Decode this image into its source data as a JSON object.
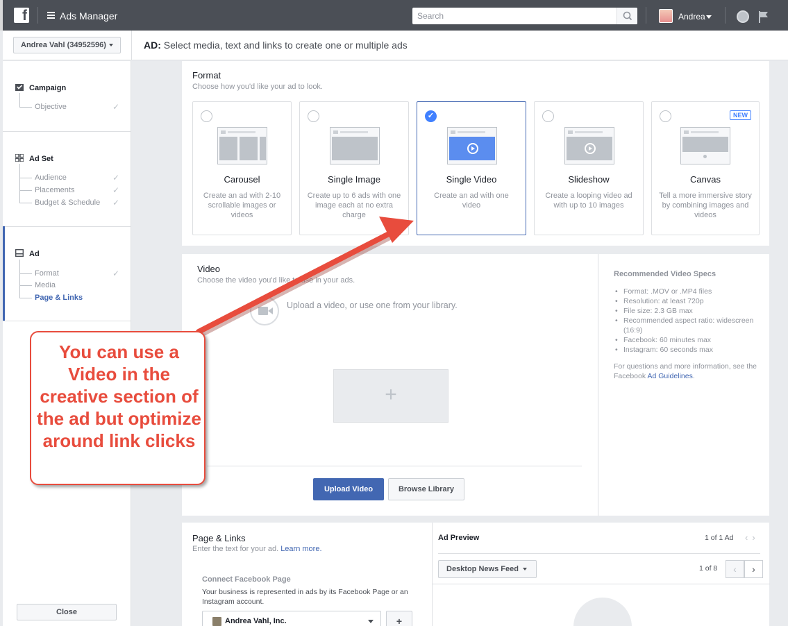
{
  "topbar": {
    "logo": "f",
    "app_title": "Ads Manager",
    "search_placeholder": "Search",
    "user_name": "Andrea"
  },
  "subheader": {
    "account": "Andrea Vahl (34952596)",
    "heading_prefix": "AD:",
    "heading_text": "Select media, text and links to create one or multiple ads"
  },
  "sidebar": {
    "campaign": {
      "title": "Campaign",
      "items": [
        {
          "label": "Objective",
          "done": true
        }
      ]
    },
    "adset": {
      "title": "Ad Set",
      "items": [
        {
          "label": "Audience",
          "done": true
        },
        {
          "label": "Placements",
          "done": true
        },
        {
          "label": "Budget & Schedule",
          "done": true
        }
      ]
    },
    "ad": {
      "title": "Ad",
      "items": [
        {
          "label": "Format",
          "done": true
        },
        {
          "label": "Media",
          "done": false
        },
        {
          "label": "Page & Links",
          "done": false,
          "active": true
        }
      ]
    },
    "close_label": "Close",
    "check_glyph": "✓"
  },
  "format": {
    "title": "Format",
    "subtitle": "Choose how you'd like your ad to look.",
    "selected": "Single Video",
    "new_badge": "NEW",
    "cards": [
      {
        "title": "Carousel",
        "desc": "Create an ad with 2-10 scrollable images or videos"
      },
      {
        "title": "Single Image",
        "desc": "Create up to 6 ads with one image each at no extra charge"
      },
      {
        "title": "Single Video",
        "desc": "Create an ad with one video"
      },
      {
        "title": "Slideshow",
        "desc": "Create a looping video ad with up to 10 images"
      },
      {
        "title": "Canvas",
        "desc": "Tell a more immersive story by combining images and videos"
      }
    ]
  },
  "video": {
    "title": "Video",
    "subtitle": "Choose the video you'd like to use in your ads.",
    "upload_prompt": "Upload a video, or use one from your library.",
    "drop_plus": "+",
    "upload_button": "Upload Video",
    "browse_button": "Browse Library",
    "specs_title": "Recommended Video Specs",
    "specs": [
      "Format: .MOV or .MP4 files",
      "Resolution: at least 720p",
      "File size: 2.3 GB max",
      "Recommended aspect ratio: widescreen (16:9)",
      "Facebook: 60 minutes max",
      "Instagram: 60 seconds max"
    ],
    "specs_foot_text": "For questions and more information, see the Facebook ",
    "specs_foot_link": "Ad Guidelines",
    "specs_foot_end": "."
  },
  "page_links": {
    "title": "Page & Links",
    "subtitle_text": "Enter the text for your ad. ",
    "learn_more": "Learn more.",
    "connect_label": "Connect Facebook Page",
    "connect_desc": "Your business is represented in ads by its Facebook Page or an Instagram account.",
    "page_value": "Andrea Vahl, Inc.",
    "add_glyph": "+"
  },
  "preview": {
    "title": "Ad Preview",
    "count": "1 of 1 Ad",
    "placement": "Desktop News Feed",
    "page_count": "1 of 8",
    "prev_glyph": "‹",
    "next_glyph": "›"
  },
  "annotation": {
    "text": "You can use a Video in the creative section of the ad but optimize around link clicks",
    "color": "#e84c3d"
  },
  "colors": {
    "brand": "#4267b2",
    "topbar": "#4b4f56",
    "accent": "#4080ff"
  }
}
